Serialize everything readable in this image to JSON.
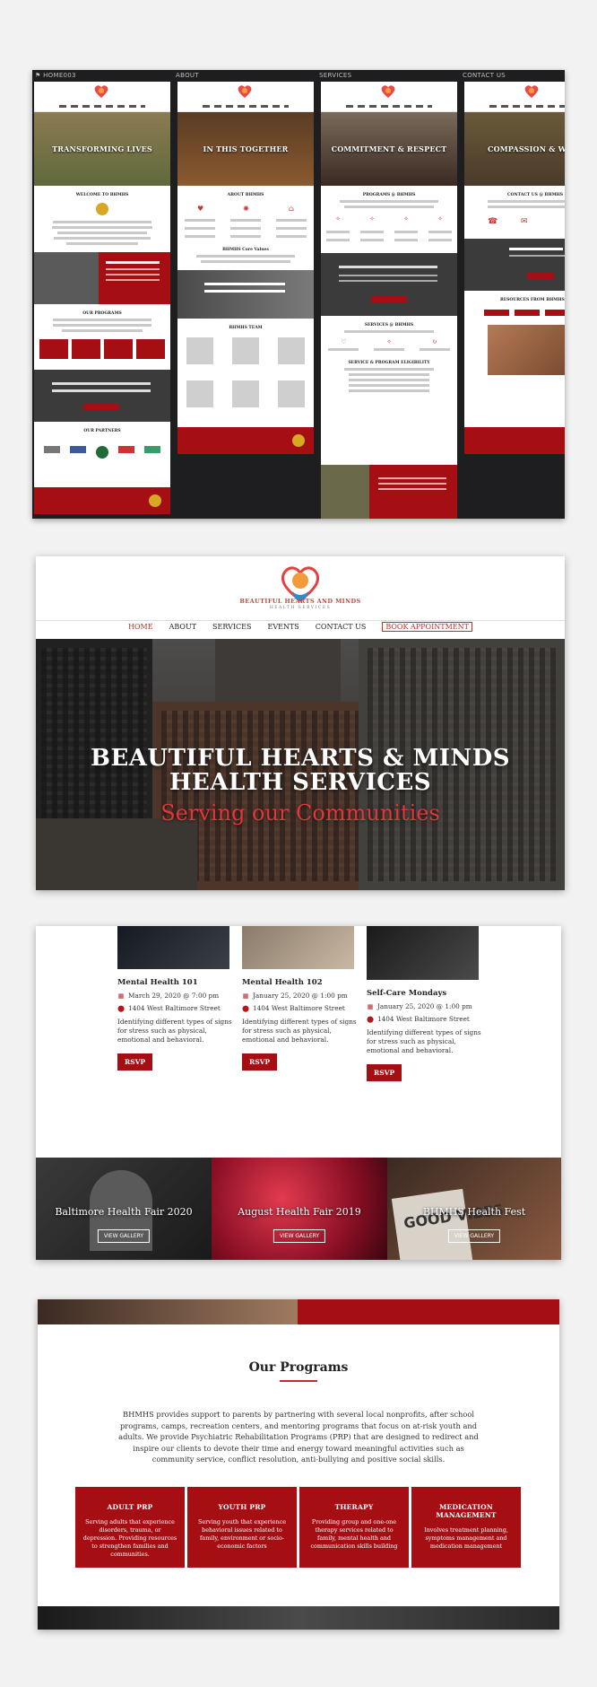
{
  "overview": {
    "columns": [
      "HOME003",
      "ABOUT",
      "SERVICES",
      "CONTACT US"
    ],
    "heroes": [
      "TRANSFORMING LIVES",
      "IN THIS TOGETHER",
      "COMMITMENT & RESPECT",
      "COMPASSION & WELLN"
    ]
  },
  "header": {
    "logo_text": "BEAUTIFUL HEARTS AND MINDS",
    "logo_subtext": "HEALTH SERVICES",
    "nav": [
      "HOME",
      "ABOUT",
      "SERVICES",
      "EVENTS",
      "CONTACT US",
      "BOOK APPOINTMENT"
    ]
  },
  "hero": {
    "title_line1": "BEAUTIFUL HEARTS & MINDS",
    "title_line2": "HEALTH SERVICES",
    "subtitle": "Serving our Communities"
  },
  "events": [
    {
      "title": "Mental Health 101",
      "date": "March 29, 2020 @ 7:00 pm",
      "location": "1404 West Baltimore Street",
      "desc": "Identifying different types of signs for stress such as physical, emotional and behavioral.",
      "button": "RSVP"
    },
    {
      "title": "Mental Health 102",
      "date": "January 25, 2020 @ 1:00 pm",
      "location": "1404 West Baltimore Street",
      "desc": "Identifying different types of signs for stress such as physical, emotional and behavioral.",
      "button": "RSVP"
    },
    {
      "title": "Self-Care Mondays",
      "date": "January 25, 2020 @ 1:00 pm",
      "location": "1404 West Baltimore Street",
      "desc": "Identifying different types of signs for stress such as physical, emotional and behavioral.",
      "button": "RSVP"
    }
  ],
  "fairs": [
    {
      "title": "Baltimore Health Fair 2020",
      "button": "VIEW GALLERY"
    },
    {
      "title": "August Health Fair 2019",
      "button": "VIEW GALLERY"
    },
    {
      "title": "BHMHS Health Fest",
      "button": "VIEW GALLERY"
    }
  ],
  "programs": {
    "heading": "Our Programs",
    "intro": "BHMHS provides support to parents by partnering with several local nonprofits, after school programs, camps, recreation centers, and mentoring programs that focus on at-risk youth and adults. We provide Psychiatric Rehabilitation Programs (PRP) that are designed to redirect and inspire our clients to devote their time and energy toward meaningful activities such as community service, conflict resolution, anti-bullying and positive social skills.",
    "items": [
      {
        "title": "ADULT PRP",
        "desc": "Serving adults that experience disorders, trauma, or depression. Providing resources to strengthen families and communities."
      },
      {
        "title": "YOUTH PRP",
        "desc": "Serving youth that experience behavioral issues related to family, environment or socio-economic factors"
      },
      {
        "title": "THERAPY",
        "desc": "Providing group and one-one therapy services related to family, mental health and communication skills building"
      },
      {
        "title": "MEDICATION MANAGEMENT",
        "desc": "Involves treatment planning, symptoms management and medication management"
      }
    ]
  },
  "colors": {
    "brand_red": "#a50f14",
    "accent_red": "#c72b2b"
  }
}
